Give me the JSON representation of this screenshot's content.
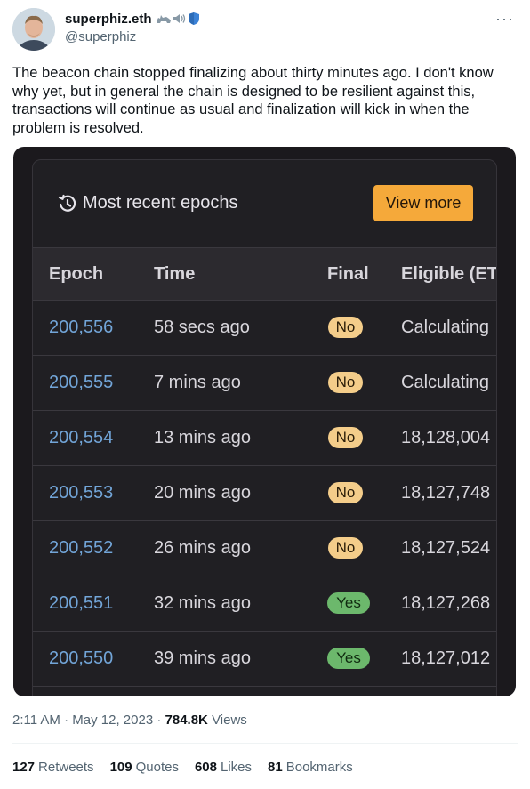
{
  "tweet": {
    "author": {
      "display_name": "superphiz.eth",
      "handle": "@superphiz",
      "name_emoji": [
        "rhino-icon",
        "speaker-icon",
        "shield-icon"
      ]
    },
    "more_icon": "more-horizontal-icon",
    "text": "The beacon chain stopped finalizing about thirty minutes ago. I don't know why yet, but in general the chain is designed to be resilient against this, transactions will continue as usual and finalization will kick in when the problem is resolved.",
    "meta": {
      "time": "2:11 AM",
      "date": "May 12, 2023",
      "views_count": "784.8K",
      "views_label": "Views"
    },
    "stats": [
      {
        "count": "127",
        "label": "Retweets"
      },
      {
        "count": "109",
        "label": "Quotes"
      },
      {
        "count": "608",
        "label": "Likes"
      },
      {
        "count": "81",
        "label": "Bookmarks"
      }
    ]
  },
  "media": {
    "title_icon": "history-icon",
    "title": "Most recent epochs",
    "view_more_label": "View more",
    "colors": {
      "background": "#1b191d",
      "card": "#201f23",
      "accent_button": "#f5a93a",
      "epoch_link": "#72a5d8",
      "badge_no": "#f4cd8a",
      "badge_yes": "#6cb86c"
    },
    "columns": [
      "Epoch",
      "Time",
      "Final",
      "Eligible (ET"
    ],
    "rows": [
      {
        "epoch": "200,556",
        "time": "58 secs ago",
        "final": "No",
        "eligible": "Calculating"
      },
      {
        "epoch": "200,555",
        "time": "7 mins ago",
        "final": "No",
        "eligible": "Calculating"
      },
      {
        "epoch": "200,554",
        "time": "13 mins ago",
        "final": "No",
        "eligible": "18,128,004"
      },
      {
        "epoch": "200,553",
        "time": "20 mins ago",
        "final": "No",
        "eligible": "18,127,748"
      },
      {
        "epoch": "200,552",
        "time": "26 mins ago",
        "final": "No",
        "eligible": "18,127,524"
      },
      {
        "epoch": "200,551",
        "time": "32 mins ago",
        "final": "Yes",
        "eligible": "18,127,268"
      },
      {
        "epoch": "200,550",
        "time": "39 mins ago",
        "final": "Yes",
        "eligible": "18,127,012"
      }
    ]
  }
}
